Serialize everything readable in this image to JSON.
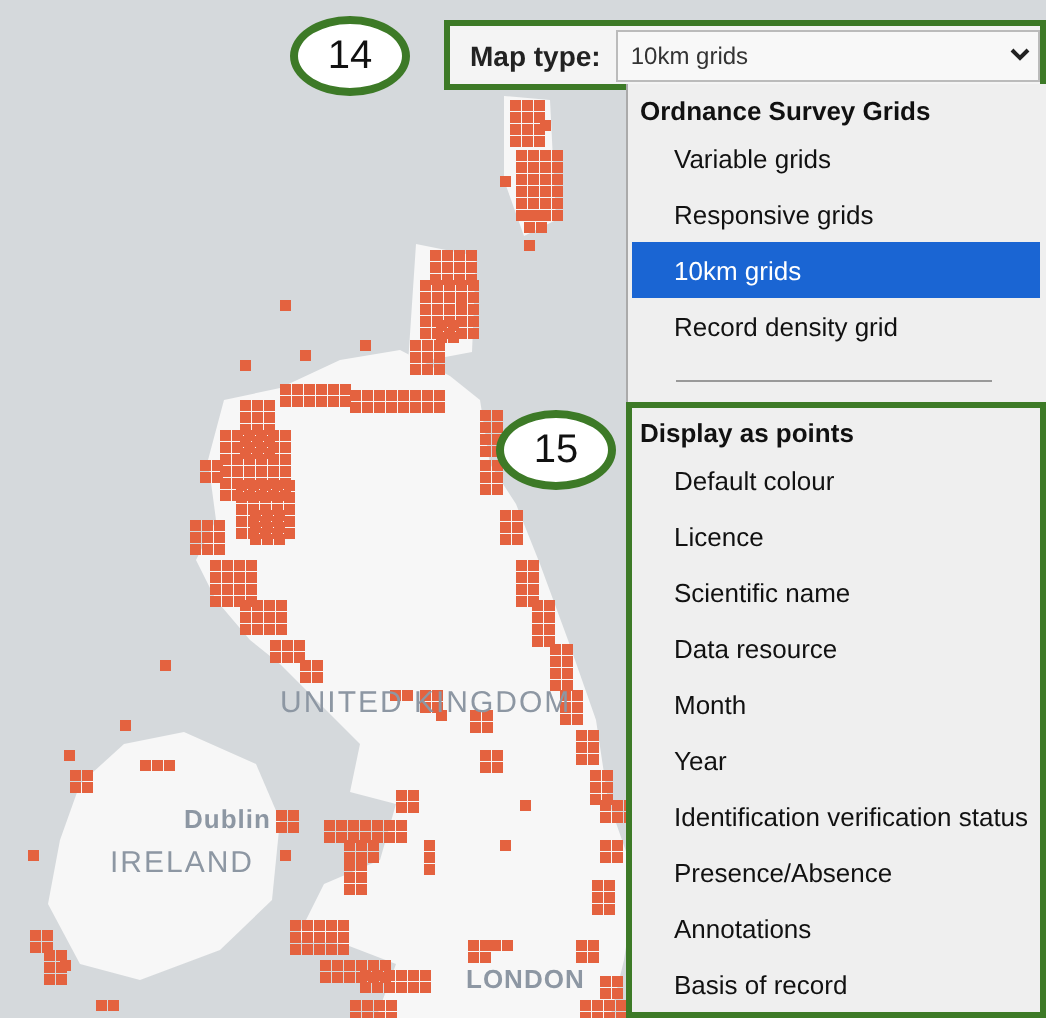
{
  "map": {
    "labels": [
      {
        "text": "UNITED KINGDOM",
        "kind": "country"
      },
      {
        "text": "Dublin",
        "kind": "city"
      },
      {
        "text": "IRELAND",
        "kind": "country"
      },
      {
        "text": "LONDON",
        "kind": "city"
      }
    ]
  },
  "callouts": [
    {
      "label": "14"
    },
    {
      "label": "15"
    }
  ],
  "map_type": {
    "label": "Map type:",
    "value": "10km grids",
    "highlighted": true
  },
  "dropdown": {
    "groups": [
      {
        "title": "Ordnance Survey Grids",
        "highlighted": false,
        "options": [
          {
            "label": "Variable grids",
            "selected": false
          },
          {
            "label": "Responsive grids",
            "selected": false
          },
          {
            "label": "10km grids",
            "selected": true
          },
          {
            "label": "Record density grid",
            "selected": false
          }
        ]
      },
      {
        "title": "Display as points",
        "highlighted": true,
        "options": [
          {
            "label": "Default colour",
            "selected": false
          },
          {
            "label": "Licence",
            "selected": false
          },
          {
            "label": "Scientific name",
            "selected": false
          },
          {
            "label": "Data resource",
            "selected": false
          },
          {
            "label": "Month",
            "selected": false
          },
          {
            "label": "Year",
            "selected": false
          },
          {
            "label": "Identification verification status",
            "selected": false
          },
          {
            "label": "Presence/Absence",
            "selected": false
          },
          {
            "label": "Annotations",
            "selected": false
          },
          {
            "label": "Basis of record",
            "selected": false
          }
        ]
      }
    ]
  }
}
